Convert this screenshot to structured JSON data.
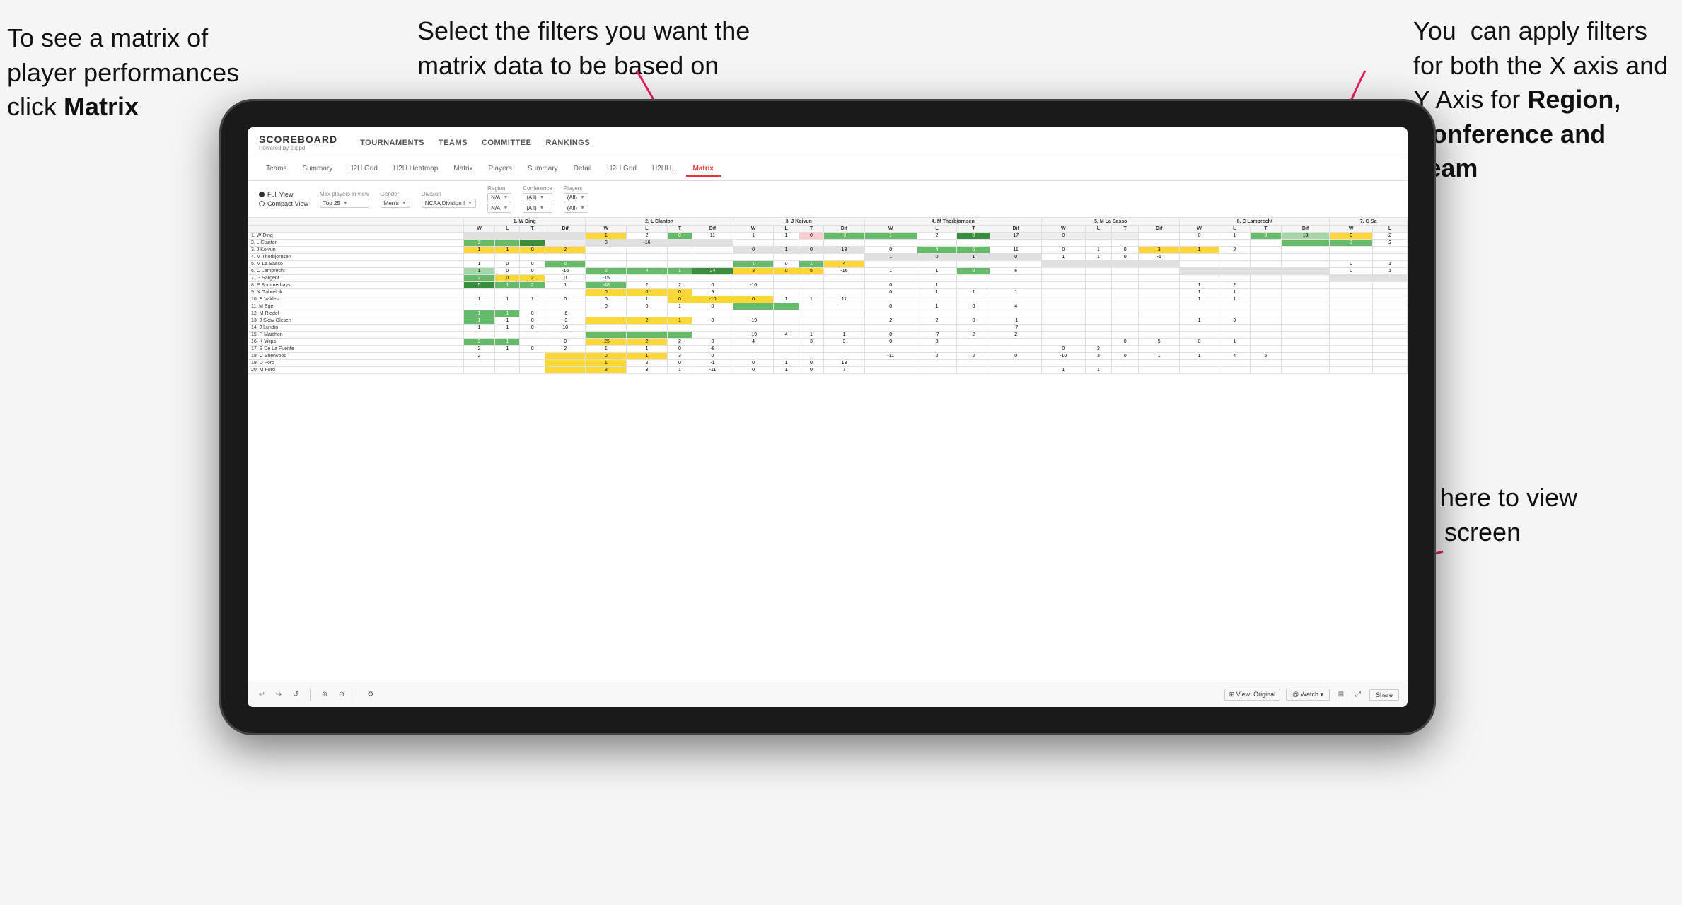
{
  "annotations": {
    "top_left": "To see a matrix of player performances click Matrix",
    "top_left_bold_part": "Matrix",
    "top_center": "Select the filters you want the matrix data to be based on",
    "top_right_line1": "You  can apply filters for both the X axis and Y Axis for ",
    "top_right_bold": "Region, Conference and Team",
    "bottom_right_line1": "Click here to view in full screen"
  },
  "app": {
    "logo_title": "SCOREBOARD",
    "logo_sub": "Powered by clippd",
    "nav_items": [
      "TOURNAMENTS",
      "TEAMS",
      "COMMITTEE",
      "RANKINGS"
    ],
    "sub_tabs": [
      "Teams",
      "Summary",
      "H2H Grid",
      "H2H Heatmap",
      "Matrix",
      "Players",
      "Summary",
      "Detail",
      "H2H Grid",
      "H2HH...",
      "Matrix"
    ],
    "active_tab": "Matrix"
  },
  "filters": {
    "view_full": "Full View",
    "view_compact": "Compact View",
    "max_players_label": "Max players in view",
    "max_players_value": "Top 25",
    "gender_label": "Gender",
    "gender_value": "Men's",
    "division_label": "Division",
    "division_value": "NCAA Division I",
    "region_label": "Region",
    "region_value1": "N/A",
    "region_value2": "N/A",
    "conference_label": "Conference",
    "conference_value1": "(All)",
    "conference_value2": "(All)",
    "players_label": "Players",
    "players_value1": "(All)",
    "players_value2": "(All)"
  },
  "matrix": {
    "col_headers": [
      "1. W Ding",
      "2. L Clanton",
      "3. J Koivun",
      "4. M Thorbjornsen",
      "5. M La Sasso",
      "6. C Lamprecht",
      "7. G Sa"
    ],
    "sub_cols": [
      "W",
      "L",
      "T",
      "Dif"
    ],
    "rows": [
      {
        "name": "1. W Ding",
        "cells": [
          "",
          "",
          "",
          "",
          "1",
          "2",
          "0",
          "11",
          "1",
          "1",
          "0",
          "-2",
          "1",
          "2",
          "0",
          "17",
          "0",
          "",
          "",
          "",
          "0",
          "1",
          "0",
          "13",
          "0",
          "2"
        ]
      },
      {
        "name": "2. L Clanton",
        "cells": [
          "2",
          "",
          "",
          "",
          "0",
          "-16",
          "",
          "",
          "",
          "",
          "",
          "",
          "",
          "",
          "",
          "",
          "",
          "",
          "",
          "",
          "",
          "",
          "",
          "",
          "2",
          "2"
        ]
      },
      {
        "name": "3. J Koivun",
        "cells": [
          "1",
          "1",
          "0",
          "2",
          "",
          "",
          "",
          "",
          "0",
          "1",
          "0",
          "13",
          "0",
          "4",
          "0",
          "11",
          "0",
          "1",
          "0",
          "3",
          "1",
          "2"
        ]
      },
      {
        "name": "4. M Thorbjornsen",
        "cells": [
          "",
          "",
          "",
          "",
          "",
          "",
          "",
          "",
          "",
          "",
          "",
          "",
          "1",
          "0",
          "1",
          "0",
          "1",
          "1",
          "0",
          "-6",
          "",
          "",
          "",
          "",
          "",
          "",
          ""
        ]
      },
      {
        "name": "5. M La Sasso",
        "cells": [
          "1",
          "0",
          "0",
          "6",
          "",
          "",
          "",
          "",
          "1",
          "0",
          "1",
          "4",
          "",
          "",
          "",
          "",
          "",
          "",
          "",
          "",
          "",
          "",
          "",
          "",
          "0",
          "1"
        ]
      },
      {
        "name": "6. C Lamprecht",
        "cells": [
          "1",
          "0",
          "0",
          "-16",
          "2",
          "4",
          "1",
          "24",
          "3",
          "0",
          "5",
          "-16",
          "1",
          "1",
          "0",
          "6",
          "",
          "",
          "",
          "",
          "",
          "",
          "",
          "",
          "0",
          "1"
        ]
      },
      {
        "name": "7. G Sargent",
        "cells": [
          "2",
          "0",
          "2",
          "0",
          "-15",
          "",
          "",
          "",
          "",
          "",
          "",
          "",
          "",
          "",
          "",
          "",
          "",
          "",
          "",
          ""
        ]
      },
      {
        "name": "8. P Summerhays",
        "cells": [
          "5",
          "1",
          "2",
          "1",
          "-48",
          "2",
          "2",
          "0",
          "-16",
          "",
          "",
          "",
          "0",
          "1",
          "",
          "",
          "",
          "",
          "",
          "",
          "1",
          "2"
        ]
      },
      {
        "name": "9. N Gabrelcik",
        "cells": [
          "",
          "",
          "",
          "",
          "0",
          "0",
          "0",
          "9",
          "",
          "",
          "",
          "",
          "0",
          "1",
          "1",
          "1",
          "",
          "",
          "",
          "",
          "1",
          "1"
        ]
      },
      {
        "name": "10. B Valdes",
        "cells": [
          "1",
          "1",
          "1",
          "0",
          "0",
          "1",
          "0",
          "-10",
          "0",
          "1",
          "1",
          "11",
          "",
          "",
          "",
          "",
          "",
          "",
          "",
          "",
          "1",
          "1"
        ]
      },
      {
        "name": "11. M Ege",
        "cells": [
          "",
          "",
          "",
          "",
          "0",
          "0",
          "1",
          "0",
          "",
          "",
          "",
          "",
          "0",
          "1",
          "0",
          "4",
          ""
        ]
      },
      {
        "name": "12. M Riedel",
        "cells": [
          "1",
          "1",
          "0",
          "-6",
          "",
          "",
          "",
          "",
          "",
          "",
          "",
          "",
          "",
          "",
          "",
          "",
          ""
        ]
      },
      {
        "name": "13. J Skov Olesen",
        "cells": [
          "1",
          "1",
          "0",
          "-3",
          "",
          "2",
          "1",
          "0",
          "-19",
          "",
          "",
          "",
          "2",
          "2",
          "0",
          "-1",
          "",
          "",
          "",
          "",
          "1",
          "3"
        ]
      },
      {
        "name": "14. J Lundin",
        "cells": [
          "1",
          "1",
          "0",
          "10",
          "",
          "",
          "",
          "",
          "",
          "",
          "",
          "",
          "",
          "",
          "",
          "-7",
          ""
        ]
      },
      {
        "name": "15. P Maichon",
        "cells": [
          "",
          "",
          "",
          "",
          "",
          "",
          "",
          "",
          "-19",
          "4",
          "1",
          "1",
          "0",
          "-7",
          "2",
          "2"
        ]
      },
      {
        "name": "16. K Vilips",
        "cells": [
          "3",
          "1",
          "",
          "0",
          "-25",
          "2",
          "2",
          "0",
          "4",
          "",
          "3",
          "3",
          "0",
          "8",
          "",
          "",
          "",
          "",
          "0",
          "5",
          "0",
          "1"
        ]
      },
      {
        "name": "17. S De La Fuente",
        "cells": [
          "2",
          "1",
          "0",
          "2",
          "1",
          "1",
          "0",
          "-8",
          "",
          "",
          "",
          "",
          "",
          "",
          "",
          "",
          "0",
          "2"
        ]
      },
      {
        "name": "18. C Sherwood",
        "cells": [
          "2",
          "",
          "",
          "",
          "0",
          "1",
          "3",
          "0",
          "",
          "",
          "",
          "",
          "-11",
          "2",
          "2",
          "0",
          "-10",
          "3",
          "0",
          "1",
          "1",
          "4",
          "5"
        ]
      },
      {
        "name": "19. D Ford",
        "cells": [
          "",
          "",
          "",
          "",
          "1",
          "2",
          "0",
          "-1",
          "0",
          "1",
          "0",
          "13",
          "",
          "",
          "",
          "",
          ""
        ]
      },
      {
        "name": "20. M Ford",
        "cells": [
          "",
          "",
          "",
          "",
          "3",
          "3",
          "1",
          "-11",
          "0",
          "1",
          "0",
          "7",
          "",
          "",
          "",
          "",
          "1",
          "1"
        ]
      }
    ]
  },
  "bottom_bar": {
    "view_original": "⊞ View: Original",
    "watch": "@ Watch ▾",
    "share": "Share"
  }
}
